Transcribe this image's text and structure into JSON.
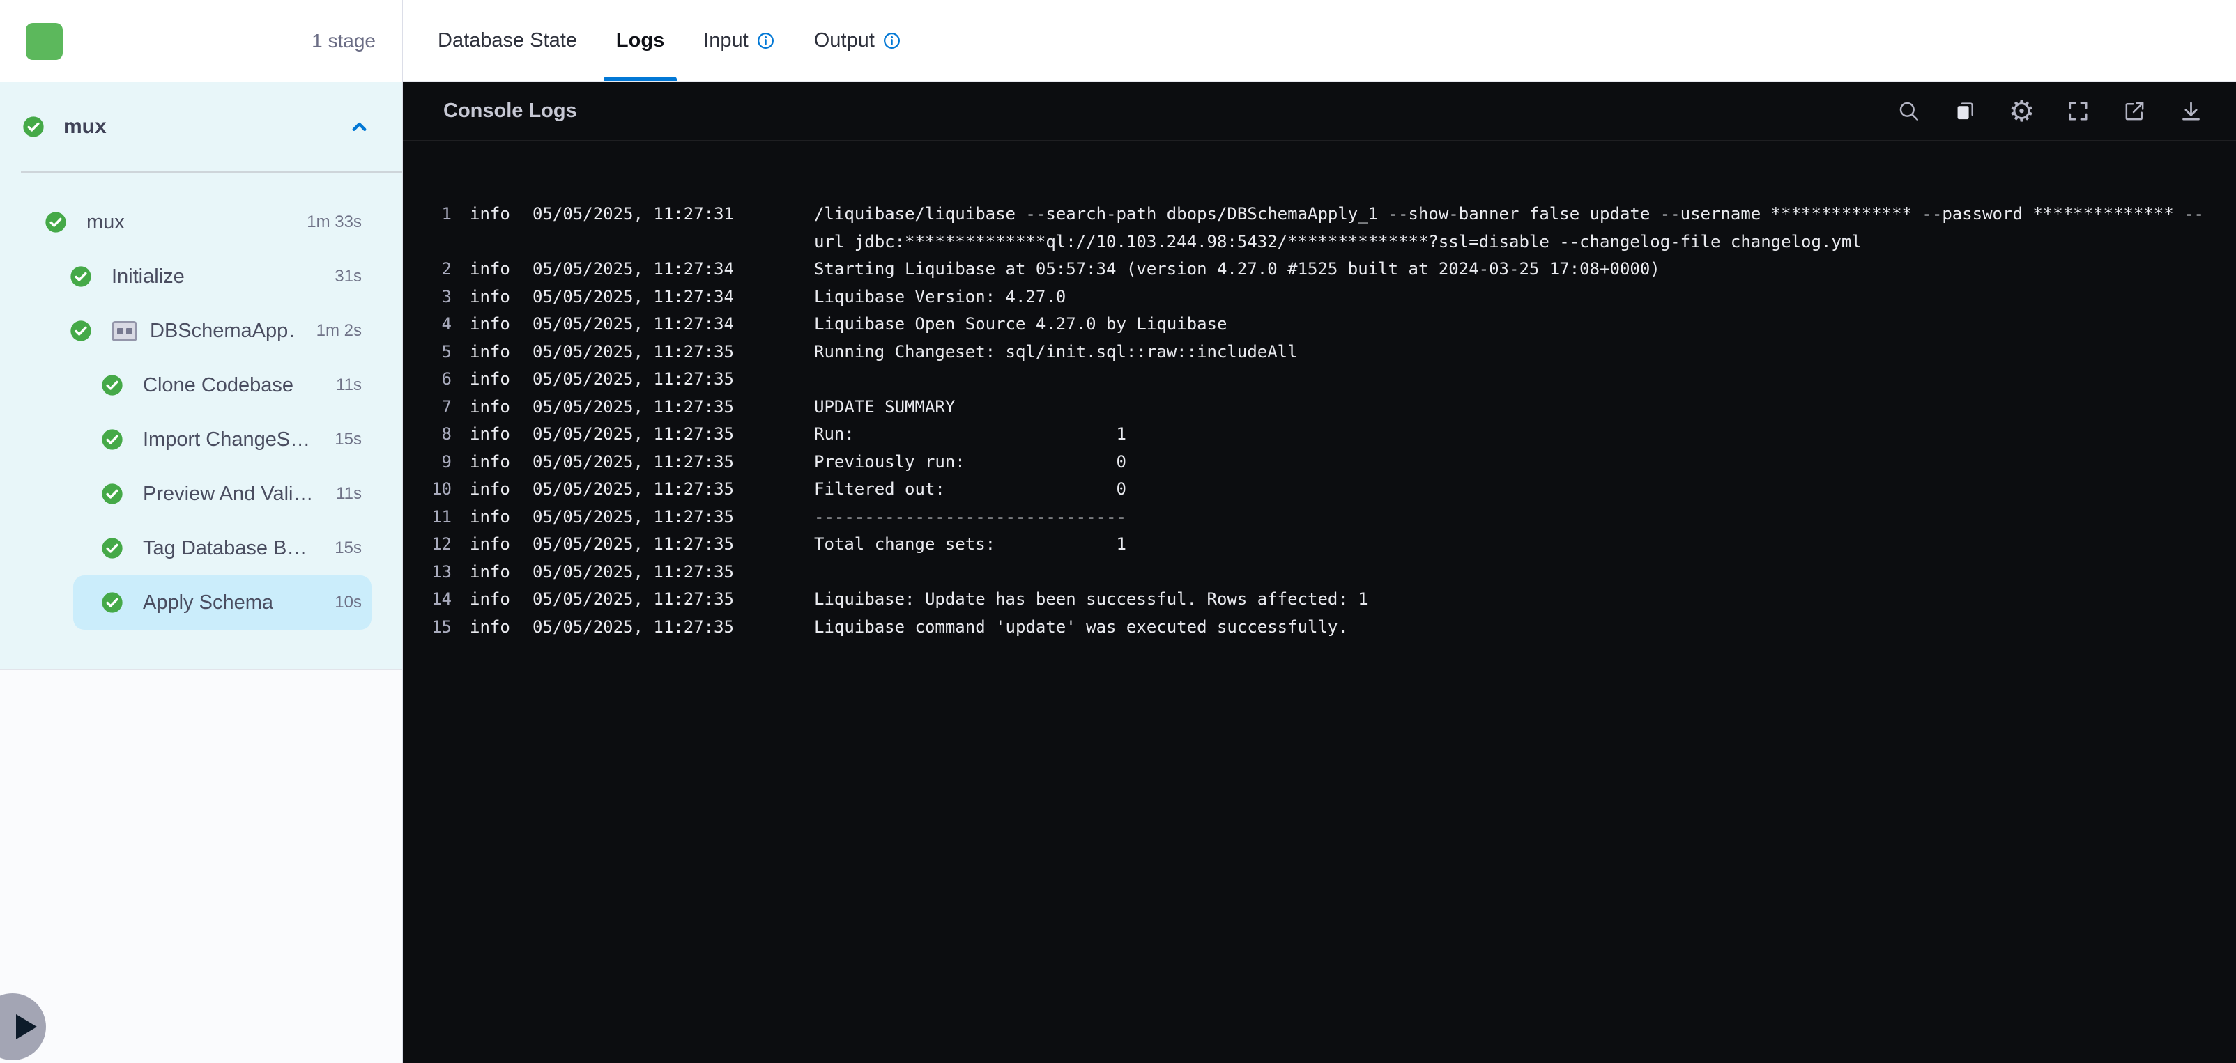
{
  "colors": {
    "accent": "#0278d5",
    "success": "#45a948",
    "console-bg": "#0c0d10",
    "sidebar-panel-bg": "#e8f6f9",
    "selected-bg": "#cbedfb"
  },
  "sidebar": {
    "stage_count_label": "1 stage",
    "stage": {
      "name": "mux",
      "items": [
        {
          "label": "mux",
          "duration": "1m 33s",
          "level": 1,
          "status": "success"
        },
        {
          "label": "Initialize",
          "duration": "31s",
          "level": 2,
          "status": "success"
        },
        {
          "label": "DBSchemaApp…",
          "duration": "1m 2s",
          "level": 2,
          "status": "success",
          "group": true
        },
        {
          "label": "Clone Codebase",
          "duration": "11s",
          "level": 3,
          "status": "success"
        },
        {
          "label": "Import ChangeS…",
          "duration": "15s",
          "level": 3,
          "status": "success"
        },
        {
          "label": "Preview And Vali…",
          "duration": "11s",
          "level": 3,
          "status": "success"
        },
        {
          "label": "Tag Database B…",
          "duration": "15s",
          "level": 3,
          "status": "success"
        },
        {
          "label": "Apply Schema",
          "duration": "10s",
          "level": 3,
          "status": "success",
          "selected": true
        }
      ]
    }
  },
  "tabs": [
    {
      "label": "Database State",
      "active": false,
      "info": false
    },
    {
      "label": "Logs",
      "active": true,
      "info": false
    },
    {
      "label": "Input",
      "active": false,
      "info": true
    },
    {
      "label": "Output",
      "active": false,
      "info": true
    }
  ],
  "console": {
    "title": "Console Logs",
    "toolbar_icons": [
      "search-icon",
      "copy-icon",
      "settings-icon",
      "fullscreen-icon",
      "open-in-new-icon",
      "download-icon"
    ],
    "logs": [
      {
        "n": "1",
        "level": "info",
        "time": "05/05/2025, 11:27:31",
        "message": "/liquibase/liquibase --search-path dbops/DBSchemaApply_1 --show-banner false update --username ************** --password ************** --url jdbc:**************ql://10.103.244.98:5432/**************?ssl=disable --changelog-file changelog.yml"
      },
      {
        "n": "2",
        "level": "info",
        "time": "05/05/2025, 11:27:34",
        "message": "Starting Liquibase at 05:57:34 (version 4.27.0 #1525 built at 2024-03-25 17:08+0000)"
      },
      {
        "n": "3",
        "level": "info",
        "time": "05/05/2025, 11:27:34",
        "message": "Liquibase Version: 4.27.0"
      },
      {
        "n": "4",
        "level": "info",
        "time": "05/05/2025, 11:27:34",
        "message": "Liquibase Open Source 4.27.0 by Liquibase"
      },
      {
        "n": "5",
        "level": "info",
        "time": "05/05/2025, 11:27:35",
        "message": "Running Changeset: sql/init.sql::raw::includeAll"
      },
      {
        "n": "6",
        "level": "info",
        "time": "05/05/2025, 11:27:35",
        "message": ""
      },
      {
        "n": "7",
        "level": "info",
        "time": "05/05/2025, 11:27:35",
        "message": "UPDATE SUMMARY"
      },
      {
        "n": "8",
        "level": "info",
        "time": "05/05/2025, 11:27:35",
        "message": "Run:                          1"
      },
      {
        "n": "9",
        "level": "info",
        "time": "05/05/2025, 11:27:35",
        "message": "Previously run:               0"
      },
      {
        "n": "10",
        "level": "info",
        "time": "05/05/2025, 11:27:35",
        "message": "Filtered out:                 0"
      },
      {
        "n": "11",
        "level": "info",
        "time": "05/05/2025, 11:27:35",
        "message": "-------------------------------"
      },
      {
        "n": "12",
        "level": "info",
        "time": "05/05/2025, 11:27:35",
        "message": "Total change sets:            1"
      },
      {
        "n": "13",
        "level": "info",
        "time": "05/05/2025, 11:27:35",
        "message": ""
      },
      {
        "n": "14",
        "level": "info",
        "time": "05/05/2025, 11:27:35",
        "message": "Liquibase: Update has been successful. Rows affected: 1"
      },
      {
        "n": "15",
        "level": "info",
        "time": "05/05/2025, 11:27:35",
        "message": "Liquibase command 'update' was executed successfully."
      }
    ]
  }
}
